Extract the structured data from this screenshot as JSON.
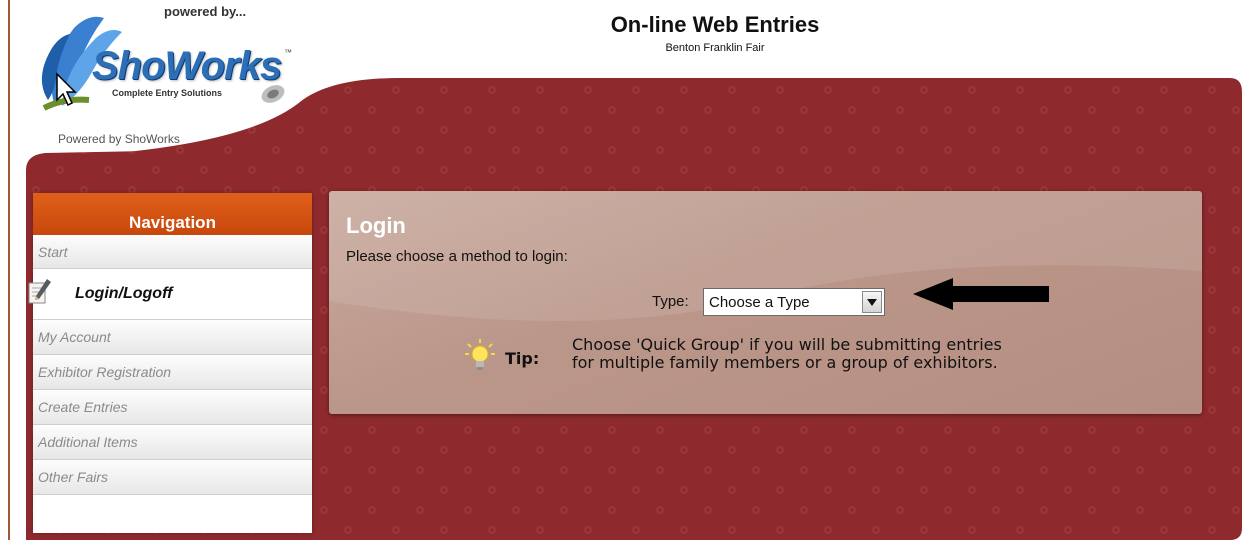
{
  "header": {
    "powered_by_top": "powered by...",
    "logo_text": "ShoWorks",
    "logo_tagline": "Complete Entry Solutions",
    "logo_tm": "™",
    "powered_by_bottom": "Powered by ShoWorks",
    "title": "On-line Web Entries",
    "subtitle": "Benton Franklin Fair"
  },
  "navigation": {
    "heading": "Navigation",
    "items": [
      {
        "label": "Start"
      },
      {
        "label": "Login/Logoff",
        "active": true
      },
      {
        "label": "My Account"
      },
      {
        "label": "Exhibitor Registration"
      },
      {
        "label": "Create Entries"
      },
      {
        "label": "Additional Items"
      },
      {
        "label": "Other Fairs"
      }
    ]
  },
  "login": {
    "title": "Login",
    "instruction": "Please choose a method to login:",
    "type_label": "Type:",
    "type_value": "Choose a Type",
    "tip_label": "Tip:",
    "tip_line1": "Choose 'Quick Group' if you will be submitting entries",
    "tip_line2": "for multiple family members or a group of exhibitors."
  },
  "colors": {
    "maroon": "#8e2a2e",
    "nav_orange": "#d2541a",
    "panel": "#bf9d91",
    "logo_blue": "#2d6fb6"
  },
  "icons": [
    "feather-logo-icon",
    "pencil-paper-icon",
    "lightbulb-icon",
    "dropdown-arrow-icon",
    "pointer-arrow-icon",
    "mouse-cursor-icon"
  ]
}
